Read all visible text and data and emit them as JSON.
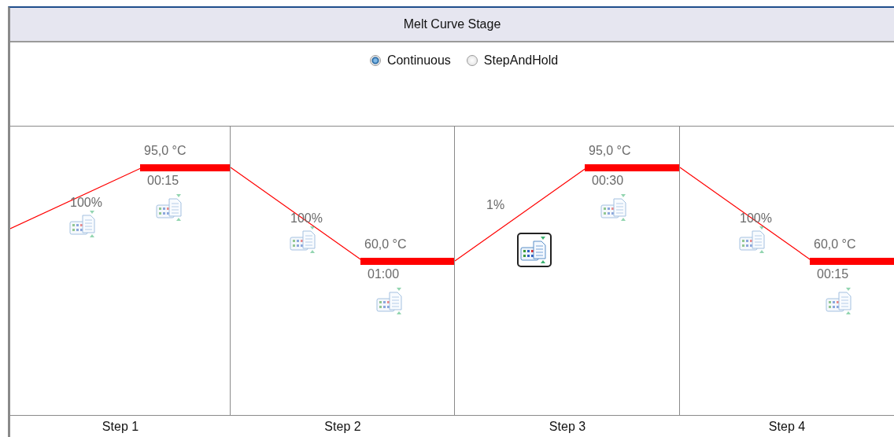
{
  "stage": {
    "title": "Melt Curve Stage"
  },
  "modes": [
    {
      "label": "Continuous",
      "selected": true
    },
    {
      "label": "StepAndHold",
      "selected": false
    }
  ],
  "steps": [
    {
      "label": "Step 1",
      "ramp": {
        "rate": "100%",
        "selected": false
      },
      "hold": {
        "temperature": "95,0 °C",
        "time": "00:15",
        "kind": "high",
        "selected": false
      }
    },
    {
      "label": "Step 2",
      "ramp": {
        "rate": "100%",
        "selected": false
      },
      "hold": {
        "temperature": "60,0 °C",
        "time": "01:00",
        "kind": "low",
        "selected": false
      }
    },
    {
      "label": "Step 3",
      "ramp": {
        "rate": "1%",
        "selected": true
      },
      "hold": {
        "temperature": "95,0 °C",
        "time": "00:30",
        "kind": "high",
        "selected": false
      }
    },
    {
      "label": "Step 4",
      "ramp": {
        "rate": "100%",
        "selected": false
      },
      "hold": {
        "temperature": "60,0 °C",
        "time": "00:15",
        "kind": "low",
        "selected": false
      }
    }
  ]
}
